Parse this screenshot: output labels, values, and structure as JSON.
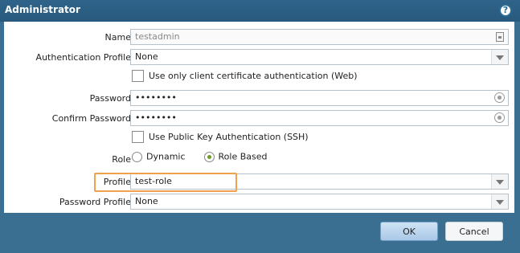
{
  "window": {
    "title": "Administrator"
  },
  "form": {
    "name": {
      "label": "Name",
      "value": "testadmin"
    },
    "auth_profile": {
      "label": "Authentication Profile",
      "value": "None"
    },
    "client_cert": {
      "label": "Use only client certificate authentication (Web)",
      "checked": false
    },
    "password": {
      "label": "Password",
      "value": "••••••••"
    },
    "confirm_password": {
      "label": "Confirm Password",
      "value": "••••••••"
    },
    "public_key": {
      "label": "Use Public Key Authentication (SSH)",
      "checked": false
    },
    "role": {
      "label": "Role",
      "options": [
        "Dynamic",
        "Role Based"
      ],
      "selected": "Role Based"
    },
    "profile": {
      "label": "Profile",
      "value": "test-role"
    },
    "password_profile": {
      "label": "Password Profile",
      "value": "None"
    }
  },
  "buttons": {
    "ok": "OK",
    "cancel": "Cancel"
  },
  "colors": {
    "titlebar": "#2f6389",
    "highlight": "#f1a04b",
    "radio_selected": "#6f9b2c"
  }
}
